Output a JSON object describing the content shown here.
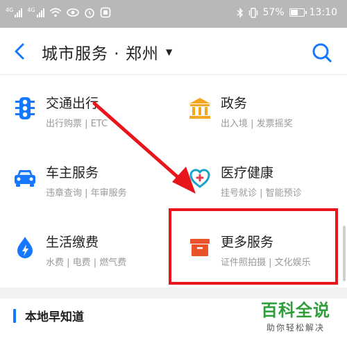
{
  "status_bar": {
    "signal_label_1": "4G",
    "signal_label_2": "4G",
    "battery_text": "57%",
    "battery_level": 0.57,
    "time": "13:10"
  },
  "header": {
    "title": "城市服务 · 郑州",
    "caret": "▼"
  },
  "services": [
    {
      "title": "交通出行",
      "subtitle": "出行购票 | ETC",
      "icon": "traffic-light-icon",
      "color": "#1677ff"
    },
    {
      "title": "政务",
      "subtitle": "出入境 | 发票摇奖",
      "icon": "government-building-icon",
      "color": "#f5a623"
    },
    {
      "title": "车主服务",
      "subtitle": "违章查询 | 年审服务",
      "icon": "car-icon",
      "color": "#1677ff"
    },
    {
      "title": "医疗健康",
      "subtitle": "挂号就诊 | 智能预诊",
      "icon": "stethoscope-icon",
      "color": "#1aa3c9"
    },
    {
      "title": "生活缴费",
      "subtitle": "水费 | 电费 | 燃气费",
      "icon": "water-drop-bolt-icon",
      "color": "#1677ff"
    },
    {
      "title": "更多服务",
      "subtitle": "证件照拍摄 | 文化娱乐",
      "icon": "box-icon",
      "color": "#e8532a"
    }
  ],
  "local_section": {
    "title": "本地早知道"
  },
  "watermark": {
    "main": "百科全说",
    "sub": "助你轻松解决"
  },
  "colors": {
    "accent": "#1677ff",
    "highlight": "#e8151c",
    "watermark_green": "#2f9d3a"
  }
}
